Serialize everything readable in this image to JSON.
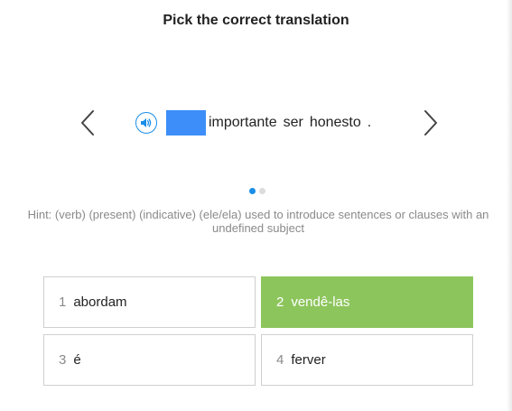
{
  "header": {
    "title": "Pick the correct translation"
  },
  "sentence": {
    "words": [
      "importante",
      "ser",
      "honesto",
      "."
    ]
  },
  "pagination": {
    "total": 2,
    "current": 1
  },
  "hint": "Hint: (verb) (present) (indicative) (ele/ela) used to introduce sentences or clauses with an undefined subject",
  "options": [
    {
      "number": "1",
      "label": "abordam",
      "selected": false
    },
    {
      "number": "2",
      "label": "vendê-las",
      "selected": true
    },
    {
      "number": "3",
      "label": "é",
      "selected": false
    },
    {
      "number": "4",
      "label": "ferver",
      "selected": false
    }
  ],
  "icons": {
    "audio": "speaker-icon",
    "prev": "chevron-left-icon",
    "next": "chevron-right-icon"
  },
  "colors": {
    "accent": "#1a8ee8",
    "blank": "#3d8ef8",
    "selected_option": "#8dc55d",
    "hint_text": "#8a8a8a"
  }
}
